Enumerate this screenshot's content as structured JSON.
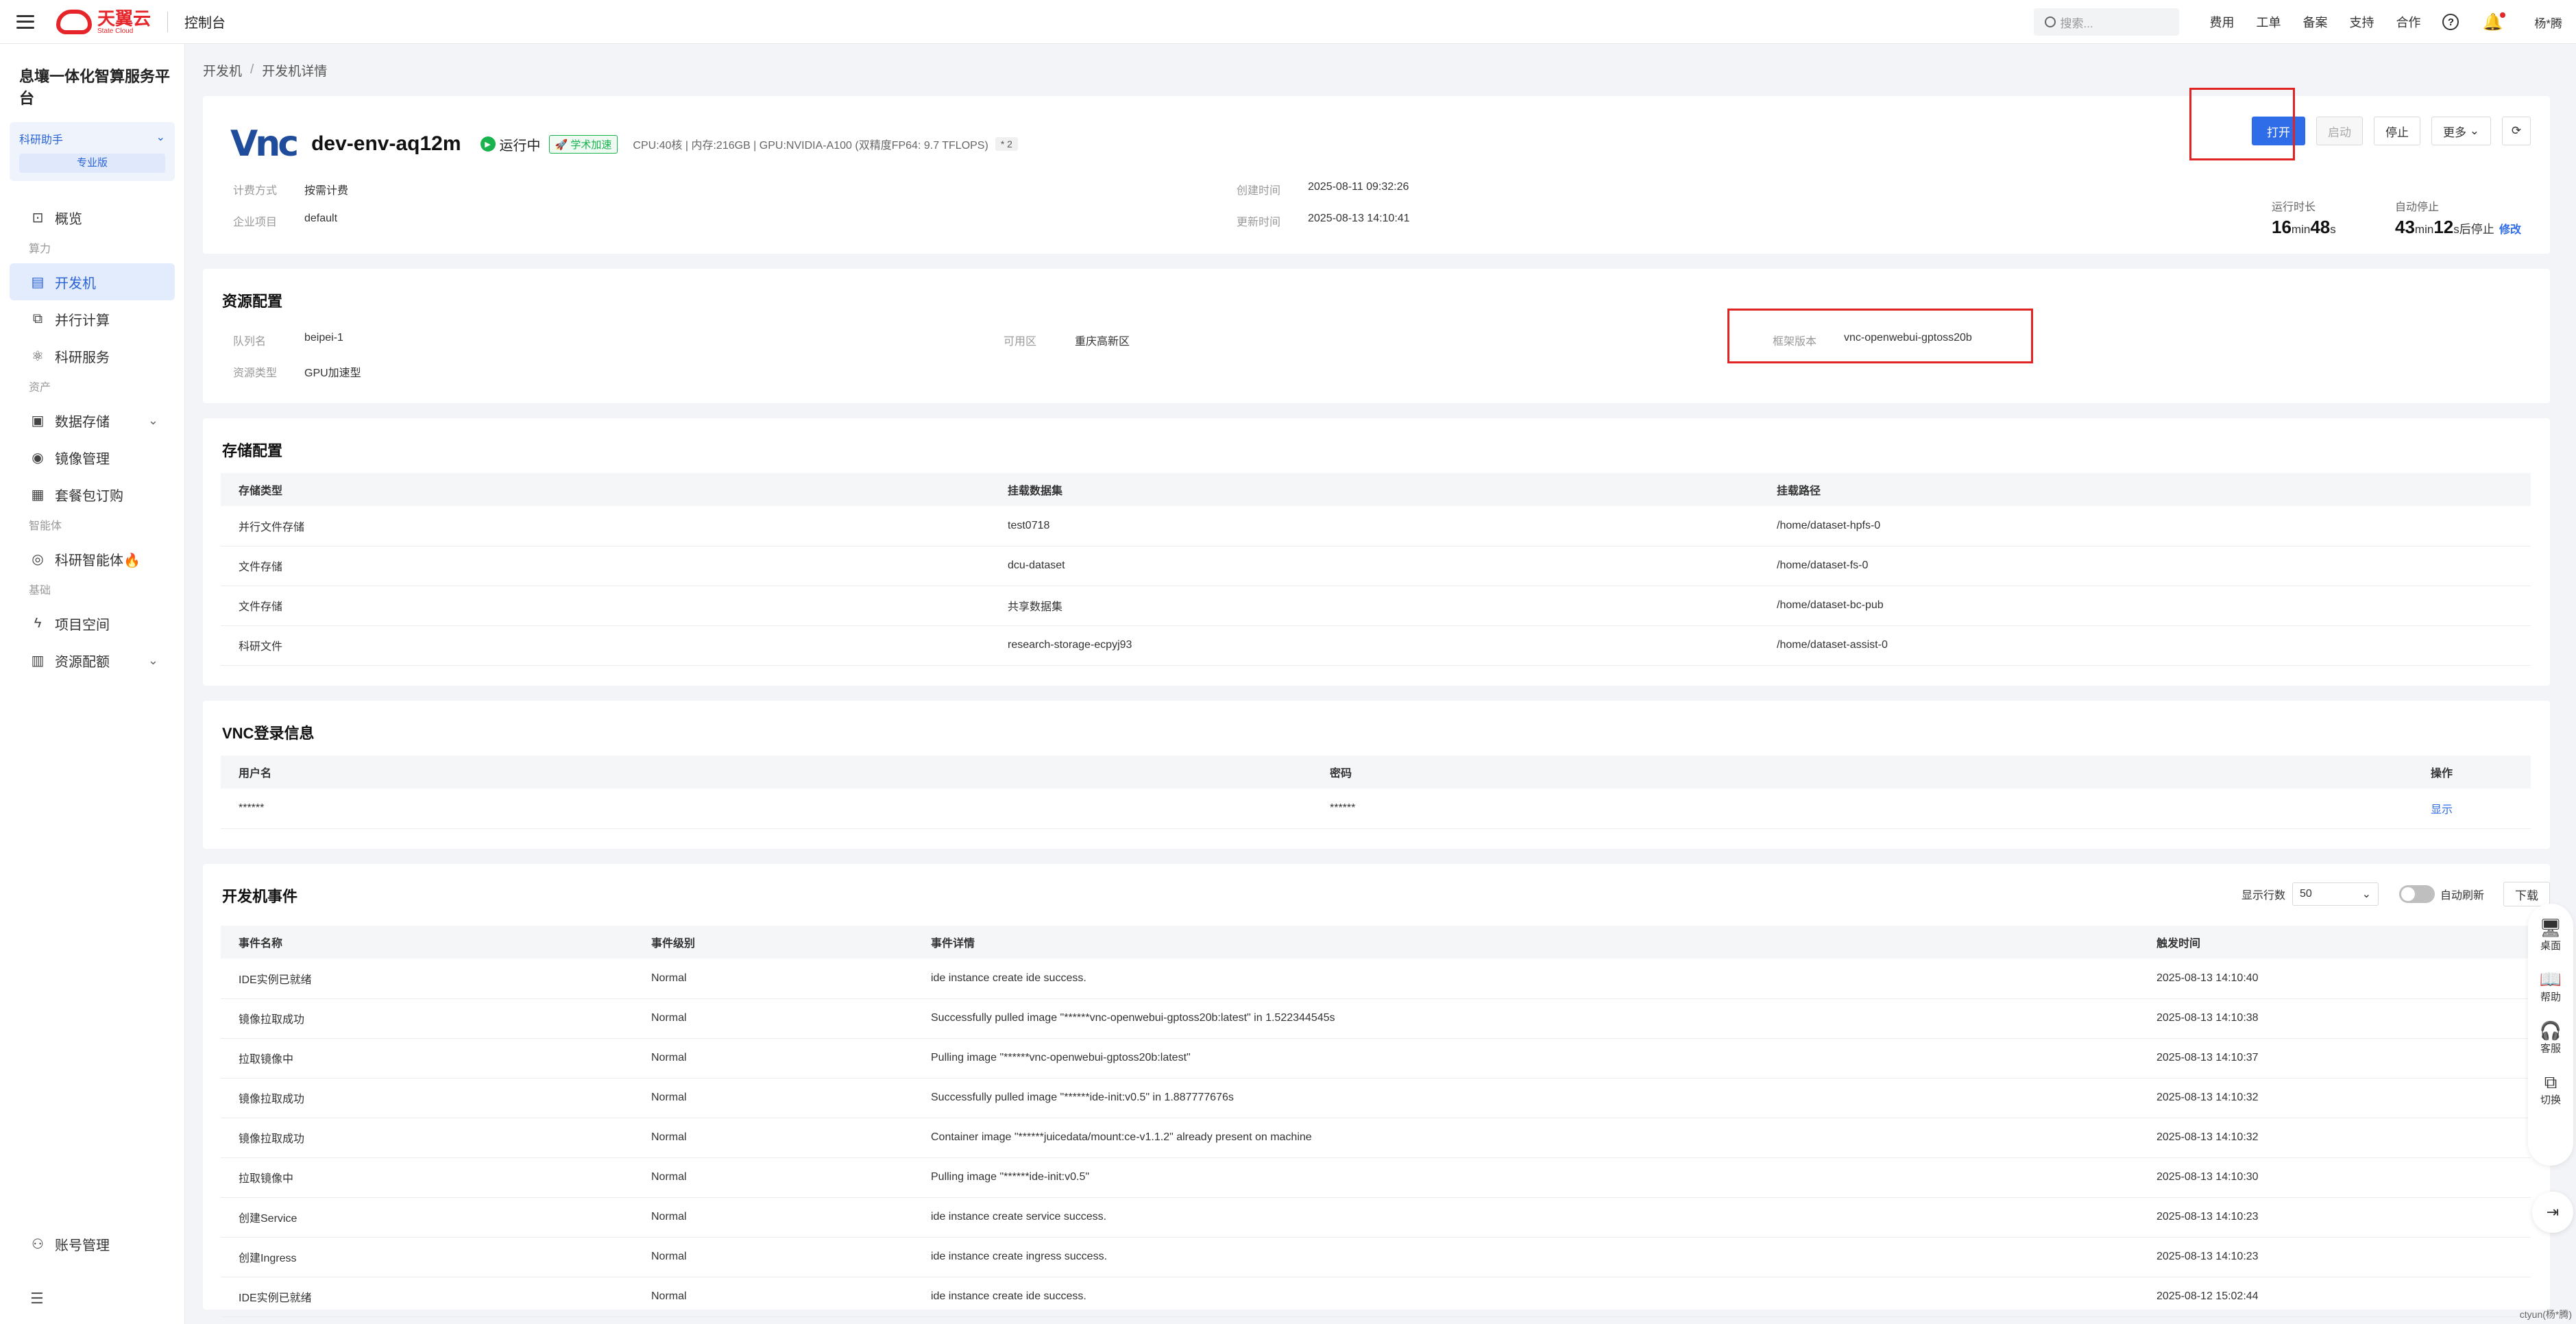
{
  "topbar": {
    "logo_cn": "天翼云",
    "logo_en": "State Cloud",
    "console": "控制台",
    "search_placeholder": "搜索...",
    "links": [
      "费用",
      "工单",
      "备案",
      "支持",
      "合作"
    ],
    "help_icon": "?",
    "user": "杨*腾"
  },
  "sidebar": {
    "platform": "息壤一体化智算服务平台",
    "assistant": "科研助手",
    "edition": "专业版",
    "overview": "概览",
    "group_compute": "算力",
    "dev_machine": "开发机",
    "parallel": "并行计算",
    "research_service": "科研服务",
    "group_assets": "资产",
    "data_storage": "数据存储",
    "image_mgmt": "镜像管理",
    "package": "套餐包订购",
    "group_agent": "智能体",
    "agent": "科研智能体🔥",
    "group_base": "基础",
    "project": "项目空间",
    "quota": "资源配额",
    "account": "账号管理"
  },
  "breadcrumb": {
    "root": "开发机",
    "current": "开发机详情"
  },
  "header": {
    "logo": "Vnc",
    "name": "dev-env-aq12m",
    "status": "运行中",
    "accel": "学术加速",
    "spec": "CPU:40核 | 内存:216GB | GPU:NVIDIA-A100 (双精度FP64: 9.7 TFLOPS)",
    "count": "* 2",
    "billing_label": "计费方式",
    "billing": "按需计费",
    "project_label": "企业项目",
    "project": "default",
    "created_label": "创建时间",
    "created": "2025-08-11 09:32:26",
    "updated_label": "更新时间",
    "updated": "2025-08-13 14:10:41",
    "btn_open": "打开",
    "btn_start": "启动",
    "btn_stop": "停止",
    "btn_more": "更多",
    "runtime_label": "运行时长",
    "runtime_min": "16",
    "runtime_sec": "48",
    "autostop_label": "自动停止",
    "autostop_min": "43",
    "autostop_sec": "12",
    "unit_min": "min",
    "unit_sec": "s",
    "autostop_suffix": "后停止",
    "edit": "修改"
  },
  "resource": {
    "title": "资源配置",
    "queue_label": "队列名",
    "queue": "beipei-1",
    "zone_label": "可用区",
    "zone": "重庆高新区",
    "framework_label": "框架版本",
    "framework": "vnc-openwebui-gptoss20b",
    "type_label": "资源类型",
    "type": "GPU加速型"
  },
  "storage": {
    "title": "存储配置",
    "headers": [
      "存储类型",
      "挂载数据集",
      "挂载路径"
    ],
    "rows": [
      [
        "并行文件存储",
        "test0718",
        "/home/dataset-hpfs-0"
      ],
      [
        "文件存储",
        "dcu-dataset",
        "/home/dataset-fs-0"
      ],
      [
        "文件存储",
        "共享数据集",
        "/home/dataset-bc-pub"
      ],
      [
        "科研文件",
        "research-storage-ecpyj93",
        "/home/dataset-assist-0"
      ]
    ]
  },
  "vnc": {
    "title": "VNC登录信息",
    "headers": [
      "用户名",
      "密码",
      "操作"
    ],
    "username": "******",
    "password": "******",
    "action": "显示"
  },
  "events": {
    "title": "开发机事件",
    "rows_label": "显示行数",
    "rows_value": "50",
    "auto_refresh": "自动刷新",
    "download": "下载",
    "headers": [
      "事件名称",
      "事件级别",
      "事件详情",
      "触发时间"
    ],
    "rows": [
      [
        "IDE实例已就绪",
        "Normal",
        "ide instance create ide success.",
        "2025-08-13 14:10:40"
      ],
      [
        "镜像拉取成功",
        "Normal",
        "Successfully pulled image \"******vnc-openwebui-gptoss20b:latest\" in 1.522344545s",
        "2025-08-13 14:10:38"
      ],
      [
        "拉取镜像中",
        "Normal",
        "Pulling image \"******vnc-openwebui-gptoss20b:latest\"",
        "2025-08-13 14:10:37"
      ],
      [
        "镜像拉取成功",
        "Normal",
        "Successfully pulled image \"******ide-init:v0.5\" in 1.887777676s",
        "2025-08-13 14:10:32"
      ],
      [
        "镜像拉取成功",
        "Normal",
        "Container image \"******juicedata/mount:ce-v1.1.2\" already present on machine",
        "2025-08-13 14:10:32"
      ],
      [
        "拉取镜像中",
        "Normal",
        "Pulling image \"******ide-init:v0.5\"",
        "2025-08-13 14:10:30"
      ],
      [
        "创建Service",
        "Normal",
        "ide instance create service success.",
        "2025-08-13 14:10:23"
      ],
      [
        "创建Ingress",
        "Normal",
        "ide instance create ingress success.",
        "2025-08-13 14:10:23"
      ],
      [
        "IDE实例已就绪",
        "Normal",
        "ide instance create ide success.",
        "2025-08-12 15:02:44"
      ]
    ]
  },
  "float": {
    "desktop": "桌面",
    "help": "帮助",
    "service": "客服",
    "switch": "切换"
  },
  "corner": "ctyun(杨*腾)"
}
